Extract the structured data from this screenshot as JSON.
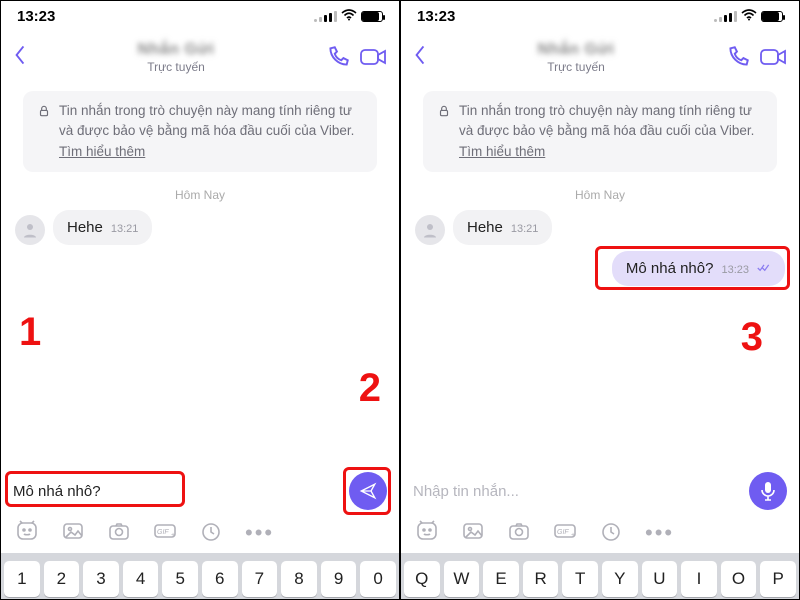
{
  "status": {
    "time": "13:23"
  },
  "header": {
    "contact_name": "Nhắn Gửi",
    "presence": "Trực tuyến"
  },
  "privacy": {
    "text": "Tin nhắn trong trò chuyện này mang tính riêng tư và được bảo vệ bằng mã hóa đầu cuối của Viber.",
    "learn_more": "Tìm hiểu thêm"
  },
  "chat": {
    "day_label": "Hôm Nay",
    "incoming": {
      "text": "Hehe",
      "time": "13:21"
    },
    "outgoing": {
      "text": "Mô nhá nhô?",
      "time": "13:23"
    }
  },
  "input": {
    "draft": "Mô nhá nhô?",
    "placeholder": "Nhập tin nhắn..."
  },
  "keyboard": {
    "numeric": [
      "1",
      "2",
      "3",
      "4",
      "5",
      "6",
      "7",
      "8",
      "9",
      "0"
    ],
    "qwerty": [
      "Q",
      "W",
      "E",
      "R",
      "T",
      "Y",
      "U",
      "I",
      "O",
      "P"
    ]
  },
  "callouts": {
    "c1": "1",
    "c2": "2",
    "c3": "3"
  }
}
